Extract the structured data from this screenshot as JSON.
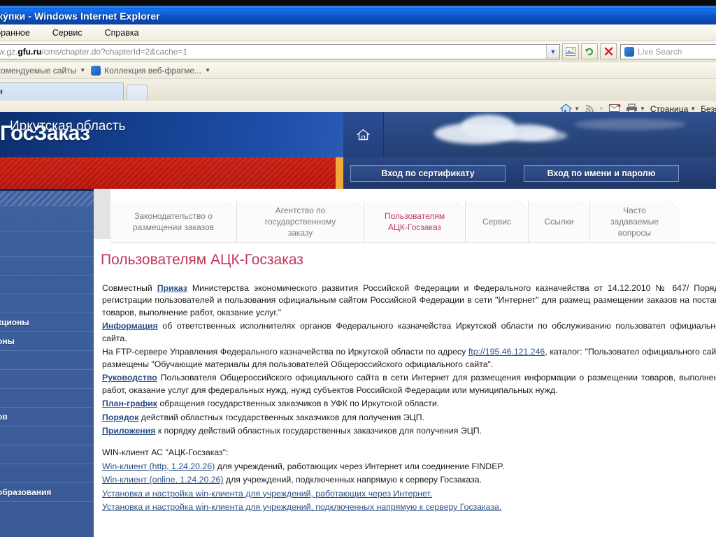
{
  "browser": {
    "title": "кýпки - Windows Internet Explorer",
    "menu": [
      "бранное",
      "Сервис",
      "Справка"
    ],
    "address": {
      "prefix": "w.gz.",
      "domain": "gfu.ru",
      "path": "/cms/chapter.do?chapterId=2&cache=1"
    },
    "search_placeholder": "Live Search",
    "favorites": [
      {
        "label": "екомендуемые сайты",
        "icon": "star-icon"
      },
      {
        "label": "Коллекция веб-фрагме...",
        "icon": "ie-icon"
      }
    ],
    "tab_label": "ки",
    "command_bar": [
      {
        "name": "home-icon",
        "label": ""
      },
      {
        "name": "feeds-icon",
        "label": ""
      },
      {
        "name": "mail-icon",
        "label": ""
      },
      {
        "name": "print-icon",
        "label": ""
      },
      {
        "name": "page-menu",
        "label": "Страница"
      },
      {
        "name": "safety-menu",
        "label": "Безоп"
      }
    ],
    "page_menu_label": "Страница",
    "safety_menu_label": "Безоп"
  },
  "site": {
    "logo": "ГосЗаказ",
    "region": "Иркутская область",
    "home_icon": "home-icon",
    "login_buttons": [
      "Вход по сертификату",
      "Вход по имени и паролю"
    ]
  },
  "sidebar": {
    "items": [
      {
        "label": "",
        "style": "hatched"
      },
      {
        "label": "",
        "style": "tall"
      },
      {
        "label": "",
        "style": "tall"
      },
      {
        "label": "",
        "style": "normal"
      },
      {
        "label": "",
        "style": "normal"
      },
      {
        "label": "",
        "style": "normal"
      },
      {
        "label": "кционы",
        "style": "normal"
      },
      {
        "label": "оны",
        "style": "normal"
      },
      {
        "label": "",
        "style": "normal"
      },
      {
        "label": "",
        "style": "normal"
      },
      {
        "label": "",
        "style": "normal"
      },
      {
        "label": "ов",
        "style": "normal"
      },
      {
        "label": "",
        "style": "normal"
      },
      {
        "label": "",
        "style": "normal"
      },
      {
        "label": "",
        "style": "normal"
      },
      {
        "label": "образования",
        "style": "normal"
      }
    ]
  },
  "nav_tabs": [
    {
      "label": "Законодательство о\nразмещении заказов",
      "active": false
    },
    {
      "label": "Агентство по\nгосударственному\nзаказу",
      "active": false
    },
    {
      "label": "Пользователям\nАЦК-Госзаказ",
      "active": true
    },
    {
      "label": "Сервис",
      "active": false
    },
    {
      "label": "Ссылки",
      "active": false
    },
    {
      "label": "Часто\nзадаваемые\nвопросы",
      "active": false
    }
  ],
  "content": {
    "heading": "Пользователям АЦК-Госзаказ",
    "p1_a": "Совместный ",
    "p1_link": "Приказ",
    "p1_b": " Министерства экономического развития Российской Федерации и Федерального казначейства от 14.12.2010 № 647/ Порядка регистрации пользователей и пользования официальным сайтом Российской Федерации в сети \"Интернет\" для размещ размещении заказов на поставки товаров, выполнение работ, оказание услуг.\"",
    "p2_link": "Информация",
    "p2_b": " об ответственных исполнителях органов Федерального казначейства Иркутской области по обслуживанию пользовател официального сайта.",
    "p3_a": "На FTP-сервере Управления Федерального казначейства по Иркутской области по адресу ",
    "p3_link": "ftp://195.46.121.246",
    "p3_b": ", каталог: \"Пользовател официального сайта\" размещены \"Обучающие материалы для пользователей Общероссийского официального сайта\".",
    "p4_link": "Руководство",
    "p4_b": " Пользователя Общероссийского официального сайта в сети Интернет для размещения информации о размещении товаров, выполнение работ, оказание услуг для федеральных нужд, нужд субъектов Российской Федерации или муниципальных нужд.",
    "p5_link": "План-график",
    "p5_b": " обращения государственных заказчиков в УФК по Иркутской области.",
    "p6_link": "Порядок",
    "p6_b": " действий областных государственных заказчиков для получения ЭЦП.",
    "p7_link": "Приложения",
    "p7_b": " к порядку действий областных государственных заказчиков для получения ЭЦП.",
    "win_header": "WIN-клиент АС \"АЦК-Госзаказ\":",
    "win_items": [
      {
        "link": "Win-клиент (http, 1.24.20.26)",
        "rest": " для учреждений, работающих через Интернет или соединение FINDEP."
      },
      {
        "link": "Win-клиент (online, 1.24.20.26)",
        "rest": " для учреждений, подключенных напрямую к серверу Госзаказа."
      },
      {
        "link": "Установка и настройка win-клиента для учреждений, работающих через Интернет.",
        "rest": ""
      },
      {
        "link": "Установка и настройка win-клиента для учреждений, подключенных напрямую к серверу Госзаказа.",
        "rest": ""
      }
    ]
  },
  "colors": {
    "brand_blue": "#15408f",
    "brand_red": "#c81b10",
    "accent_orange": "#f0a93a",
    "active_tab": "#c4375a",
    "link": "#2b4f86",
    "sidebar": "#3e609f"
  }
}
